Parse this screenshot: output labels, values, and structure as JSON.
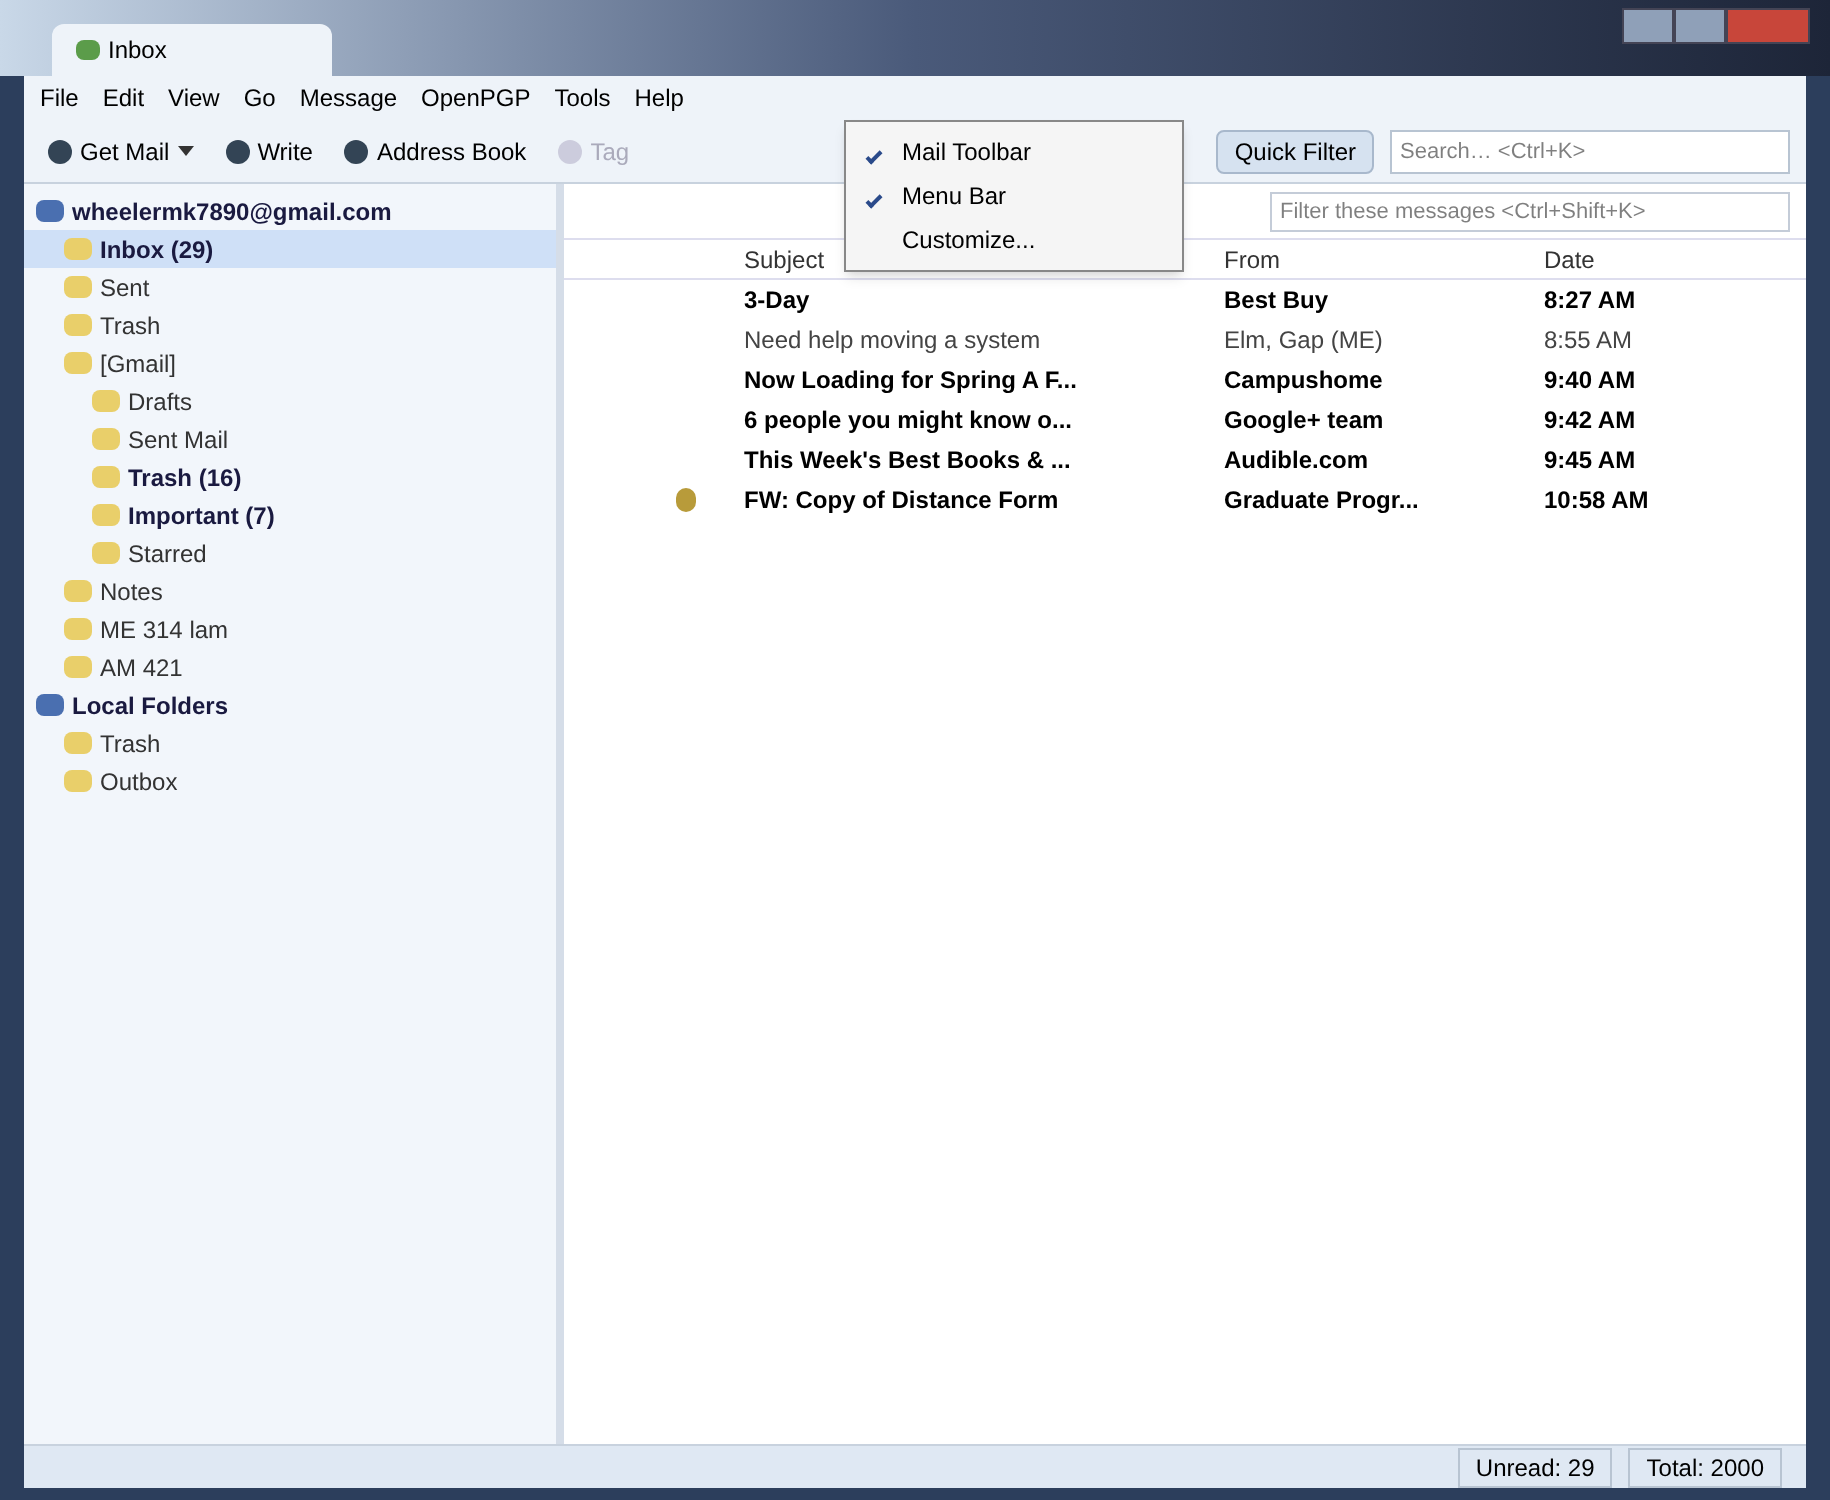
{
  "tabs": [
    {
      "label": "Inbox",
      "selected": true
    }
  ],
  "menu": [
    "File",
    "Edit",
    "View",
    "Go",
    "Message",
    "OpenPGP",
    "Tools",
    "Help"
  ],
  "toolbar": {
    "buttons": [
      {
        "label": "Get Mail",
        "kind": "dropdown"
      },
      {
        "label": "Write",
        "kind": "plain"
      },
      {
        "label": "Address Book",
        "kind": "plain"
      },
      {
        "label": "Tag",
        "kind": "faded"
      }
    ],
    "quick_filter": "Quick Filter",
    "search": {
      "placeholder": "Search… <Ctrl+K>"
    }
  },
  "context_menu": [
    {
      "label": "Mail Toolbar",
      "checked": true
    },
    {
      "label": "Menu Bar",
      "checked": true
    },
    {
      "label": "Customize...",
      "checked": false
    }
  ],
  "folders": [
    {
      "label": "wheelermk7890@gmail.com",
      "bold": true,
      "selected": false,
      "children": [
        {
          "label": "Inbox (29)",
          "bold": true,
          "selected": true
        },
        {
          "label": "Sent",
          "bold": false,
          "selected": false
        },
        {
          "label": "Trash",
          "bold": false,
          "selected": false
        },
        {
          "label": "[Gmail]",
          "bold": false,
          "selected": false,
          "children": [
            {
              "label": "Drafts",
              "bold": false,
              "selected": false
            },
            {
              "label": "Sent Mail",
              "bold": false,
              "selected": false
            },
            {
              "label": "Trash (16)",
              "bold": true,
              "selected": false
            },
            {
              "label": "Important (7)",
              "bold": true,
              "selected": false
            },
            {
              "label": "Starred",
              "bold": false,
              "selected": false
            }
          ]
        },
        {
          "label": "Notes",
          "bold": false,
          "selected": false
        },
        {
          "label": "ME 314 lam",
          "bold": false,
          "selected": false
        },
        {
          "label": "AM 421",
          "bold": false,
          "selected": false
        }
      ]
    },
    {
      "label": "Local Folders",
      "bold": true,
      "selected": false,
      "children": [
        {
          "label": "Trash",
          "bold": false,
          "selected": false
        },
        {
          "label": "Outbox",
          "bold": false,
          "selected": false
        }
      ]
    }
  ],
  "quick_filter_bar": {
    "placeholder": "Filter these messages <Ctrl+Shift+K>"
  },
  "columns": {
    "subject": "Subject",
    "from": "From",
    "date": "Date"
  },
  "messages": [
    {
      "subject": "3-Day",
      "from": "Best Buy",
      "date": "8:27 AM",
      "unread": true,
      "attachment": false
    },
    {
      "subject": "Need help moving a system",
      "from": "Elm, Gap (ME)",
      "date": "8:55 AM",
      "unread": false,
      "attachment": false
    },
    {
      "subject": "Now Loading for Spring A F...",
      "from": "Campushome",
      "date": "9:40 AM",
      "unread": true,
      "attachment": false
    },
    {
      "subject": "6 people you might know o...",
      "from": "Google+ team",
      "date": "9:42 AM",
      "unread": true,
      "attachment": false
    },
    {
      "subject": "This Week's Best Books & ...",
      "from": "Audible.com",
      "date": "9:45 AM",
      "unread": true,
      "attachment": false
    },
    {
      "subject": "FW: Copy of Distance Form",
      "from": "Graduate Progr...",
      "date": "10:58 AM",
      "unread": true,
      "attachment": true
    }
  ],
  "status_bar": {
    "unread": "Unread: 29",
    "total": "Total: 2000"
  }
}
